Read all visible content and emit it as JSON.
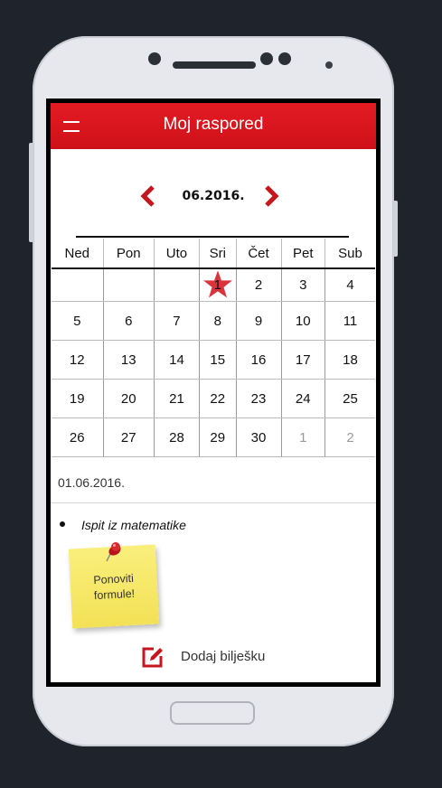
{
  "app": {
    "title": "Moj raspored",
    "accent_color": "#e31b23",
    "menu_icon": "hamburger-menu-icon"
  },
  "calendar": {
    "month_label": "06.2016.",
    "prev_icon": "chevron-left-icon",
    "next_icon": "chevron-right-icon",
    "weekdays": [
      "Ned",
      "Pon",
      "Uto",
      "Sri",
      "Čet",
      "Pet",
      "Sub"
    ],
    "weeks": [
      [
        "",
        "",
        "",
        "1",
        "2",
        "3",
        "4"
      ],
      [
        "5",
        "6",
        "7",
        "8",
        "9",
        "10",
        "11"
      ],
      [
        "12",
        "13",
        "14",
        "15",
        "16",
        "17",
        "18"
      ],
      [
        "19",
        "20",
        "21",
        "22",
        "23",
        "24",
        "25"
      ],
      [
        "26",
        "27",
        "28",
        "29",
        "30",
        "1",
        "2"
      ]
    ],
    "today_marker_icon": "star-icon",
    "today_marker_color": "#d9353d"
  },
  "selected": {
    "date_label": "01.06.2016.",
    "events": [
      {
        "title": "Ispit iz matematike"
      }
    ],
    "sticky_note": {
      "text": "Ponoviti\nformule!",
      "pin_icon": "pushpin-icon",
      "color": "#f6e86a"
    }
  },
  "actions": {
    "add_note_label": "Dodaj bilješku",
    "add_note_icon": "edit-note-icon"
  }
}
